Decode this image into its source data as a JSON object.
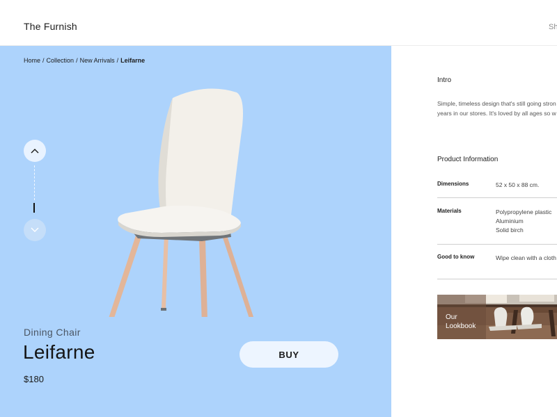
{
  "header": {
    "brand": "The Furnish",
    "nav_shop": "Sh"
  },
  "breadcrumb": {
    "items": [
      "Home",
      "Collection",
      "New Arrivals"
    ],
    "separator": "/",
    "current": "Leifarne"
  },
  "product": {
    "category": "Dining Chair",
    "name": "Leifarne",
    "price": "$180",
    "buy_label": "BUY"
  },
  "intro": {
    "title": "Intro",
    "lines": [
      "Simple, timeless design that's still going stron",
      "years in our stores. It's loved by all ages so w"
    ]
  },
  "product_information": {
    "title": "Product Information",
    "specs": [
      {
        "key": "Dimensions",
        "values": [
          "52 x 50 x 88 cm."
        ]
      },
      {
        "key": "Materials",
        "values": [
          "Polypropylene plastic",
          "Aluminium",
          "Solid birch"
        ]
      },
      {
        "key": "Good to know",
        "values": [
          "Wipe clean with a cloth"
        ]
      }
    ]
  },
  "lookbook": {
    "lines": [
      "Our",
      "Lookbook"
    ]
  },
  "icons": {
    "up": "chevron-up-icon",
    "down": "chevron-down-icon"
  },
  "colors": {
    "hero_background": "#add3fc",
    "buy_button": "#edf5ff"
  }
}
